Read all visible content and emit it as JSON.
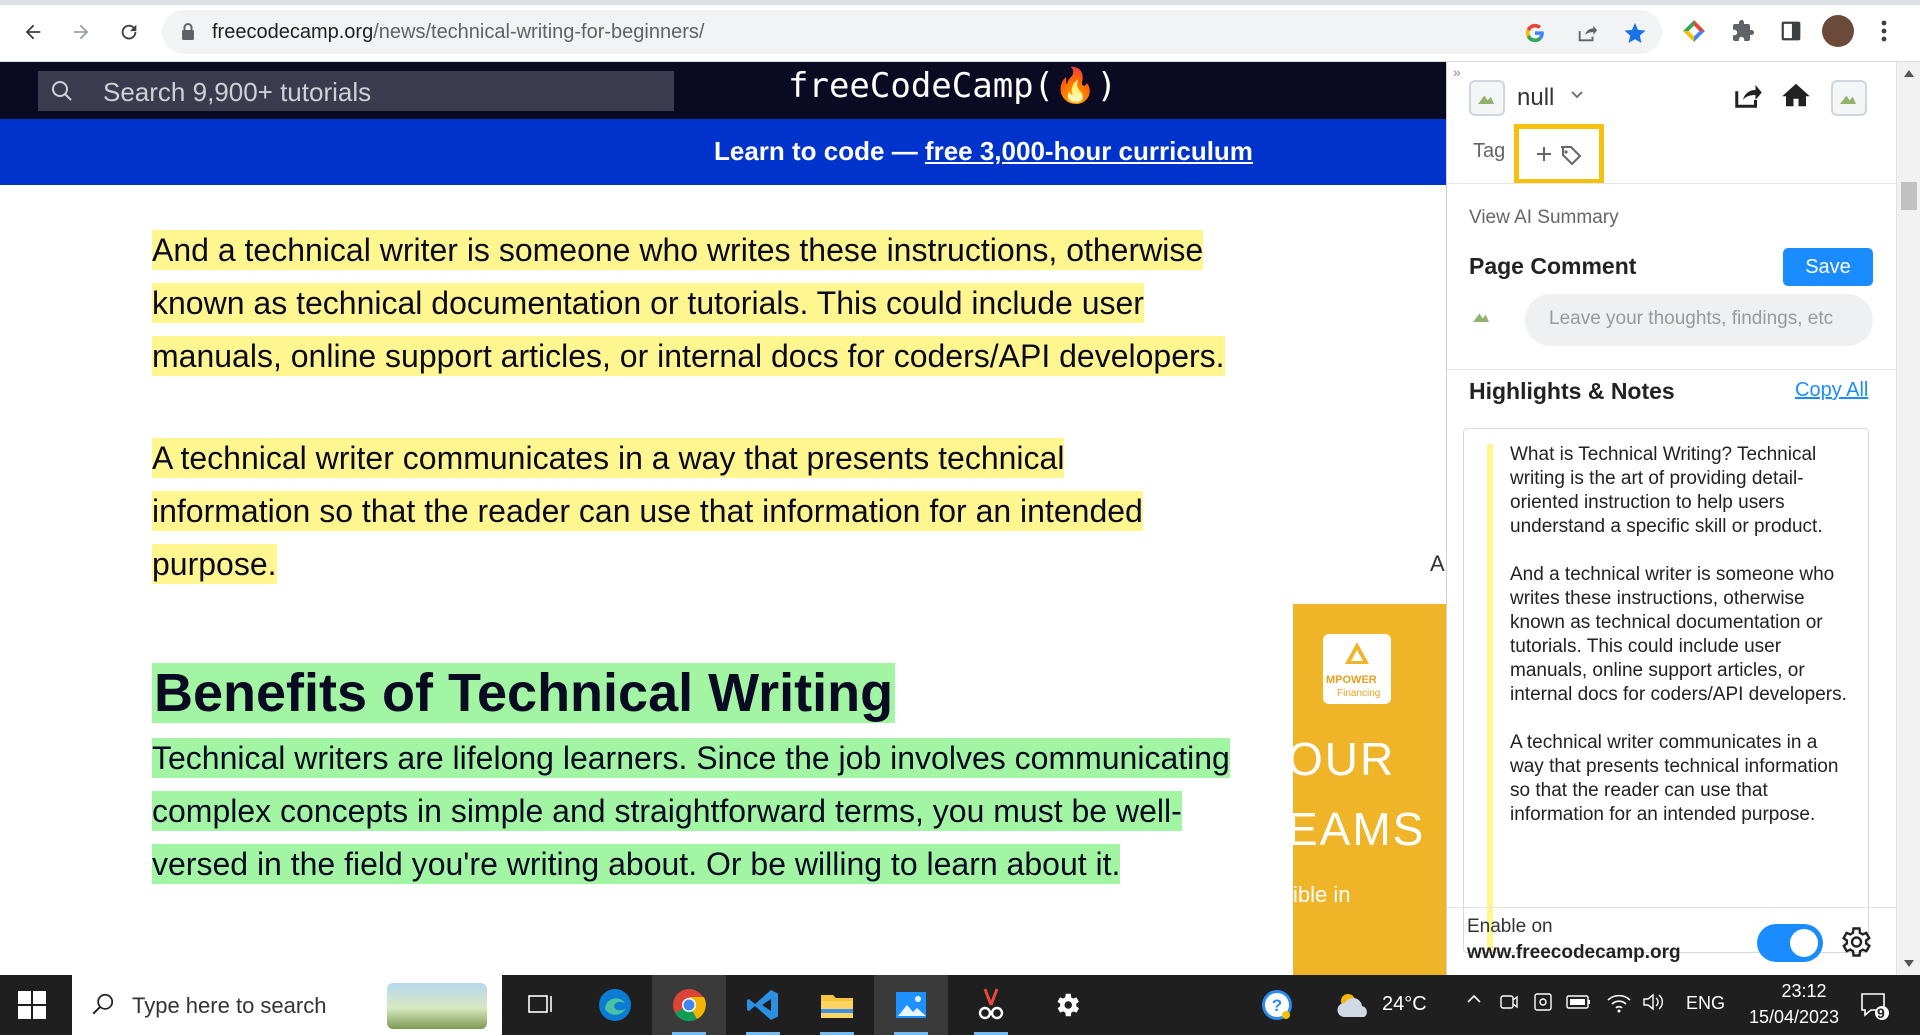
{
  "browser": {
    "url_domain": "freecodecamp.org",
    "url_path": "/news/technical-writing-for-beginners/"
  },
  "site": {
    "search_placeholder": "Search 9,900+ tutorials",
    "logo": "freeCodeCamp(🔥)",
    "banner_prefix": "Learn to code — ",
    "banner_link": "free 3,000-hour curriculum"
  },
  "article": {
    "p1": "And a technical writer is someone who writes these instructions, otherwise known as technical documentation or tutorials. This could include user manuals, online support articles, or internal docs for coders/API developers.",
    "p2": "A technical writer communicates in a way that presents technical information so that the reader can use that information for an intended purpose.",
    "heading": "Benefits of Technical Writing",
    "p3": "Technical writers are lifelong learners. Since the job involves communicating complex concepts in simple and straightforward terms, you must be well-versed in the field you're writing about. Or be willing to learn about it."
  },
  "ad": {
    "side_letter": "A",
    "brand_top": "MPOWER",
    "brand_bottom": "Financing",
    "line1": "OUR",
    "line2": "EAMS",
    "line3": "ible in"
  },
  "panel": {
    "collapse": "»",
    "user": "null",
    "tag_label": "Tag",
    "view_ai_summary": "View AI Summary",
    "page_comment_title": "Page Comment",
    "save_label": "Save",
    "comment_placeholder": "Leave your thoughts, findings, etc",
    "highlights_title": "Highlights & Notes",
    "copy_all": "Copy All",
    "notes_text": "What is Technical Writing? Technical writing is the art of providing detail-oriented instruction to help users understand a specific skill or product.\n\nAnd a technical writer is someone who writes these instructions, otherwise known as technical documentation or tutorials. This could include user manuals, online support articles, or internal docs for coders/API developers.\n\nA technical writer communicates in a way that presents technical information so that the reader can use that information for an intended purpose.",
    "enable_label": "Enable on",
    "enable_site": "www.freecodecamp.org",
    "enabled": true
  },
  "taskbar": {
    "search_placeholder": "Type here to search",
    "temperature": "24°C",
    "language": "ENG",
    "time": "23:12",
    "date": "15/04/2023",
    "notification_count": "9"
  },
  "colors": {
    "fcc_nav": "#0a0a23",
    "fcc_banner": "#0033cc",
    "highlight_yellow": "#fff68f",
    "highlight_green": "#a2f5a3",
    "accent_blue": "#1a8cff",
    "tag_outline": "#f4c20d"
  }
}
